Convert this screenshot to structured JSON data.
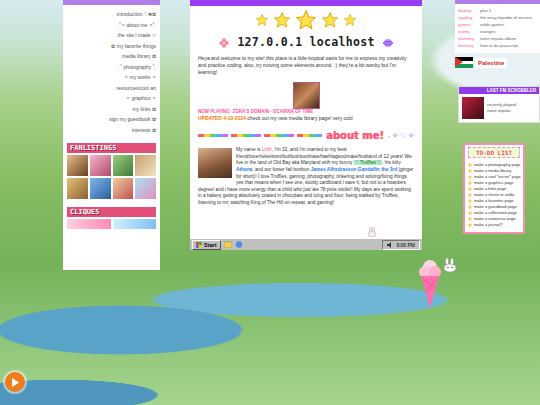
{
  "sidebar": {
    "items": [
      {
        "label": "introduction ♡❀✿"
      },
      {
        "label": "·˚✧ about me ✧˚·"
      },
      {
        "label": "the site I made ☆"
      },
      {
        "label": "✿ my favorite things"
      },
      {
        "label": "media library ✿"
      },
      {
        "label": "·˚ photography ˚·"
      },
      {
        "label": "✧ my works ✧"
      },
      {
        "label": "resources/cool art"
      },
      {
        "label": "✧ graphics ✧"
      },
      {
        "label": "my links ✿"
      },
      {
        "label": "sign my guestbook ✿"
      },
      {
        "label": "interests ✿"
      }
    ],
    "fanlistings_title": "FANLISTINGS",
    "cliques_title": "CLIQUES"
  },
  "main": {
    "title": "127.0.0.1 localhost",
    "intro": "Heya and welcome to my site! this place is a little tropical oasis for me to express my creativity and practice coding. also, try moving some elements around. :) they're a bit wonky but I'm learning!",
    "now_playing": "NOW PLAYING: ZORA'S DOMAIN - OCARINA OF TIME",
    "updated_label": "UPDATED 4-10-2024",
    "updated_text": " check out my new media library page! very cool",
    "about_title": "about me!",
    "about_deco": "˖ ✧ ♡ ✧",
    "about_segments": [
      {
        "kind": "plain",
        "text": "My name is "
      },
      {
        "kind": "name",
        "text": "Lilith"
      },
      {
        "kind": "plain",
        "text": ", I'm 32, and I'm married to my best friend/lover/television/buttbutt/soulmate/hashtagsoulmate/husband of 12 years! We live in the land of Old Bay aka Maryland with my bunny "
      },
      {
        "kind": "pet",
        "text": "♡ Truffles ♡"
      },
      {
        "kind": "plain",
        "text": ", his kitty "
      },
      {
        "kind": "link",
        "text": "Athena"
      },
      {
        "kind": "plain",
        "text": ", and our foster fail bunbun "
      },
      {
        "kind": "link",
        "text": "James Alfredrasson Gandalfin the 3rd"
      },
      {
        "kind": "plain",
        "text": " (ginger for short)! I love Truffles, gaming, photography, tinkering and solving/fixing things. yes that means when I see one, sturdy cardboard I save it, but not to a hoarders degree! and i have more energy than a child who just ate 78 pixie sticks!! My days are spent working in a bakery getting absolutely coated in chocolate and icing and flour, being stalked by Truffles, listening to rnr, watching King of The Hill on repeat, and gaming!"
      }
    ]
  },
  "taskbar": {
    "start": "Start",
    "time": "9:06 PM"
  },
  "status": {
    "rows": [
      {
        "label": "display",
        "value": "plex 1"
      },
      {
        "label": "reading",
        "value": "the encyclopedia of ancient"
      },
      {
        "label": "games",
        "value": "zelda games"
      },
      {
        "label": "eating",
        "value": "oranges"
      },
      {
        "label": "listening",
        "value": "tame impala album"
      },
      {
        "label": "learning",
        "value": "how to do javascript"
      }
    ]
  },
  "palestine": {
    "text": "Palestine"
  },
  "lastfm": {
    "title": "LAST FM SCROBBLER",
    "line1": "recently played",
    "line2": "tame impala"
  },
  "todo": {
    "title": "TO-DO LIST",
    "items": [
      {
        "label": "make a photography page"
      },
      {
        "label": "make a media library"
      },
      {
        "label": "make a cool *secret* page"
      },
      {
        "label": "make a graphics page"
      },
      {
        "label": "make a links page"
      },
      {
        "label": "make a shrine to zelda"
      },
      {
        "label": "make a favorites page"
      },
      {
        "label": "make a guestbook page"
      },
      {
        "label": "make a collections page"
      },
      {
        "label": "make a resources page"
      },
      {
        "label": "make a journal?"
      }
    ]
  }
}
